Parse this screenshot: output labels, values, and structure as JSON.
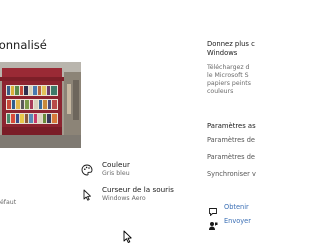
{
  "main": {
    "title": "rsonnalisé",
    "left_default_value": "éfaut",
    "settings": [
      {
        "label": "Couleur",
        "value": "Gris bleu",
        "icon": "palette-icon"
      },
      {
        "label": "Curseur de la souris",
        "value": "Windows Aero",
        "icon": "mouse-cursor-icon"
      }
    ]
  },
  "side": {
    "more_title": [
      "Donnez plus c",
      "Windows"
    ],
    "more_text": [
      "Téléchargez d",
      "le Microsoft S",
      "papiers peints",
      "couleurs"
    ],
    "related_title": "Paramètres as",
    "related_links": [
      "Paramètres de",
      "Paramètres de",
      "Synchroniser v"
    ],
    "help": [
      {
        "label": "Obtenir",
        "icon": "help-chat-icon"
      },
      {
        "label": "Envoyer",
        "icon": "feedback-icon"
      }
    ]
  },
  "colors": {
    "link": "#3b6fb5",
    "muted_text": "#6b6b6b"
  }
}
